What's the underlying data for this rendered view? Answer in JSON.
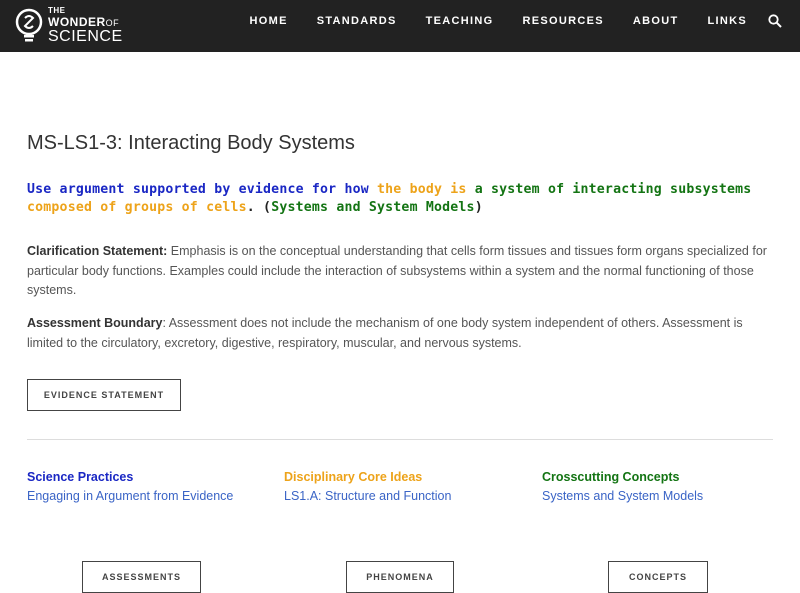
{
  "brand": {
    "the": "THE",
    "wonder": "WONDER",
    "of": "OF",
    "science": "SCIENCE"
  },
  "nav": {
    "items": [
      "HOME",
      "STANDARDS",
      "TEACHING",
      "RESOURCES",
      "ABOUT",
      "LINKS"
    ],
    "search_icon": "search-icon"
  },
  "page": {
    "title": "MS-LS1-3: Interacting Body Systems"
  },
  "standard": {
    "part1": "Use argument supported by evidence for how ",
    "part2": "the body is",
    "part3": " a system of interacting subsystems ",
    "part4": "composed of groups of cells",
    "part5": ". (",
    "part6": "Systems and System Models",
    "part7": ")"
  },
  "clarification": {
    "label": "Clarification Statement:",
    "text": " Emphasis is on the conceptual understanding that cells form tissues and tissues form organs specialized for particular body functions. Examples could include the interaction of subsystems within a system and the normal functioning of those systems."
  },
  "assessment_boundary": {
    "label": "Assessment Boundary",
    "text": ": Assessment does not include the mechanism of one body system independent of others. Assessment is limited to the circulatory, excretory, digestive, respiratory, muscular, and nervous systems."
  },
  "buttons": {
    "evidence": "EVIDENCE STATEMENT",
    "assessments": "ASSESSMENTS",
    "phenomena": "PHENOMENA",
    "concepts": "CONCEPTS"
  },
  "dimensions": {
    "science_practices": {
      "heading": "Science Practices",
      "link": "Engaging in Argument from Evidence"
    },
    "core_ideas": {
      "heading": "Disciplinary Core Ideas",
      "link": "LS1.A: Structure and Function"
    },
    "crosscutting": {
      "heading": "Crosscutting Concepts",
      "link": "Systems and System Models"
    }
  },
  "colors": {
    "header_bg": "#222222",
    "practices_blue": "#1a27c4",
    "core_orange": "#eda31a",
    "crosscutting_green": "#137413",
    "link_blue": "#3a64c6"
  }
}
